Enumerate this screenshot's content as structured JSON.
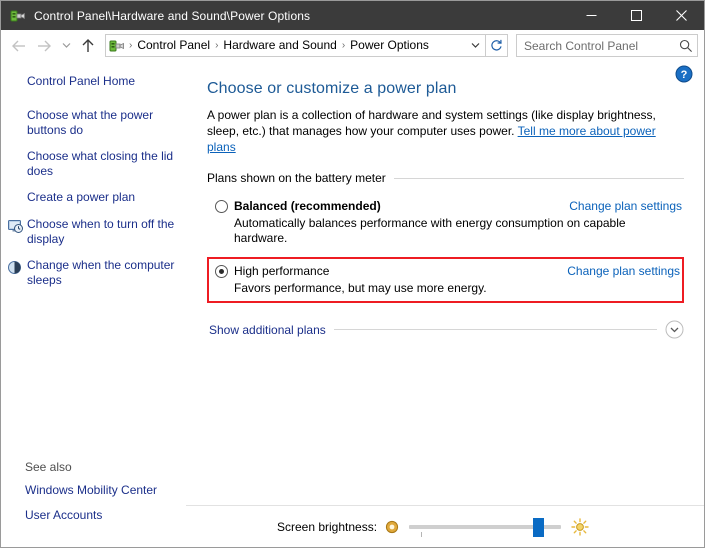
{
  "window": {
    "title": "Control Panel\\Hardware and Sound\\Power Options",
    "app_icon": "power-plug-icon",
    "minimize_label": "─",
    "maximize_label": "□",
    "close_label": "✕"
  },
  "nav": {
    "back_label": "←",
    "forward_label": "→",
    "recent_label": "⌄",
    "up_label": "↑",
    "refresh_label": "↻",
    "breadcrumb_icon": "power-plug-icon",
    "breadcrumbs": [
      {
        "label": "Control Panel"
      },
      {
        "label": "Hardware and Sound"
      },
      {
        "label": "Power Options"
      }
    ],
    "separator": "›",
    "dropdown_label": "⌄"
  },
  "search": {
    "placeholder": "Search Control Panel",
    "value": "",
    "icon": "search-icon"
  },
  "sidebar": {
    "home": {
      "label": "Control Panel Home"
    },
    "items": [
      {
        "label": "Choose what the power buttons do",
        "icon": ""
      },
      {
        "label": "Choose what closing the lid does",
        "icon": ""
      },
      {
        "label": "Create a power plan",
        "icon": ""
      },
      {
        "label": "Choose when to turn off the display",
        "icon": "monitor-clock-icon"
      },
      {
        "label": "Change when the computer sleeps",
        "icon": "moon-sleep-icon"
      }
    ],
    "see_also": {
      "heading": "See also",
      "links": [
        {
          "label": "Windows Mobility Center"
        },
        {
          "label": "User Accounts"
        }
      ]
    }
  },
  "content": {
    "help_icon": "help-question-icon",
    "title": "Choose or customize a power plan",
    "intro_text": "A power plan is a collection of hardware and system settings (like display brightness, sleep, etc.) that manages how your computer uses power. ",
    "intro_link": "Tell me more about power plans",
    "group_heading": "Plans shown on the battery meter",
    "plans": [
      {
        "name": "Balanced (recommended)",
        "description": "Automatically balances performance with energy consumption on capable hardware.",
        "link": "Change plan settings",
        "selected": false,
        "bold": true,
        "highlighted": false
      },
      {
        "name": "High performance",
        "description": "Favors performance, but may use more energy.",
        "link": "Change plan settings",
        "selected": true,
        "bold": false,
        "highlighted": true
      }
    ],
    "show_additional": {
      "label": "Show additional plans",
      "chevron": "chevron-down-icon"
    }
  },
  "brightness": {
    "label": "Screen brightness:",
    "low_icon": "brightness-low-icon",
    "high_icon": "brightness-high-icon",
    "value_percent": 88
  },
  "colors": {
    "titlebar": "#3b3b3b",
    "link": "#0b62ba",
    "sidebar_link": "#1b2f8a",
    "heading": "#1d5a96",
    "highlight_border": "#ee1c23",
    "slider_accent": "#0a6bc4"
  }
}
